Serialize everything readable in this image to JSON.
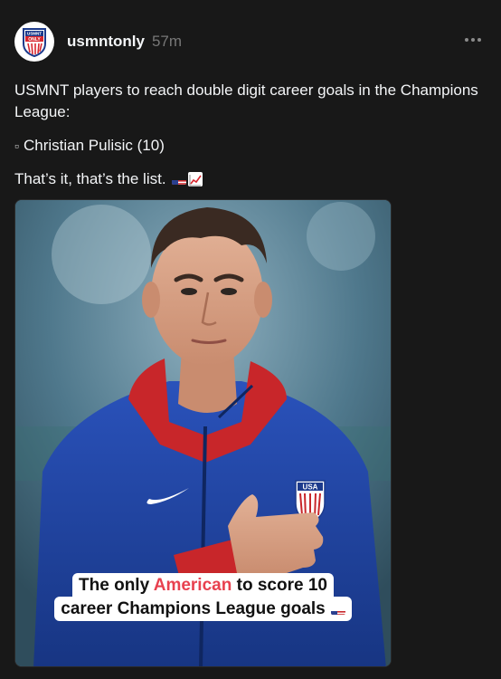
{
  "post": {
    "author": "usmntonly",
    "timestamp": "57m",
    "avatar_text": [
      "USMNT",
      "ONLY"
    ],
    "text_line_1": "USMNT players to reach double digit career goals in the Champions League:",
    "bullet_glyph": "▫",
    "bullet_item": "Christian Pulisic (10)",
    "text_line_3": "That’s it, that’s the list.",
    "emojis": [
      "us-flag-emoji",
      "chart-increasing-emoji"
    ]
  },
  "image": {
    "caption_line_1_prefix": "The only ",
    "caption_line_1_highlight": "American",
    "caption_line_1_suffix": " to score 10",
    "caption_line_2": "career Champions League goals",
    "shirt_badge": "USA",
    "colors": {
      "jersey": "#2247a8",
      "collar": "#c8262a",
      "highlight": "#e8414f"
    }
  },
  "theme": {
    "background": "#181818",
    "text": "#f3f5f7",
    "muted": "#777777"
  }
}
